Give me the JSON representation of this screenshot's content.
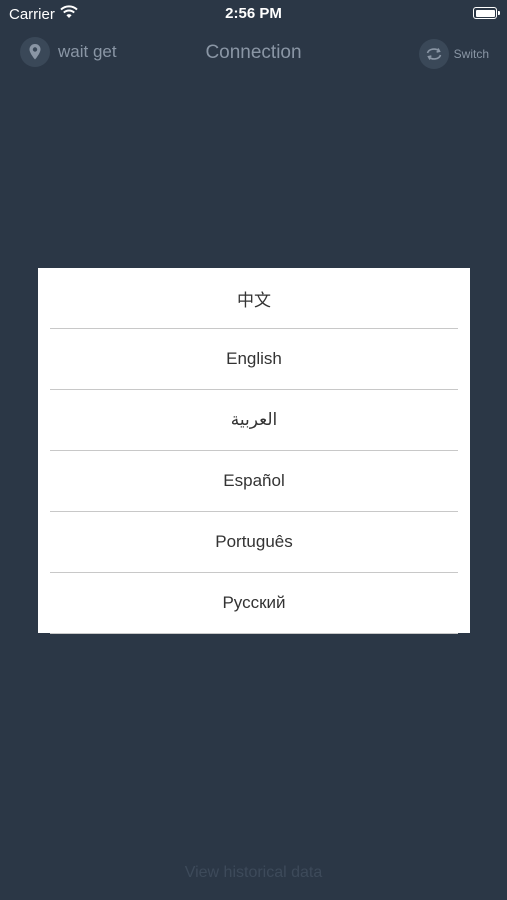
{
  "status_bar": {
    "carrier": "Carrier",
    "time": "2:56 PM"
  },
  "header": {
    "location_label": "wait get",
    "title": "Connection",
    "switch_label": "Switch"
  },
  "language_picker": {
    "options": [
      {
        "label": "中文"
      },
      {
        "label": "English"
      },
      {
        "label": "العربية"
      },
      {
        "label": "Español"
      },
      {
        "label": "Português"
      },
      {
        "label": "Русский"
      }
    ]
  },
  "footer": {
    "history_link": "View historical data"
  },
  "colors": {
    "background": "#2b3746",
    "muted_text": "#8a96a5",
    "modal_bg": "#ffffff",
    "divider": "#c8c8c8"
  }
}
